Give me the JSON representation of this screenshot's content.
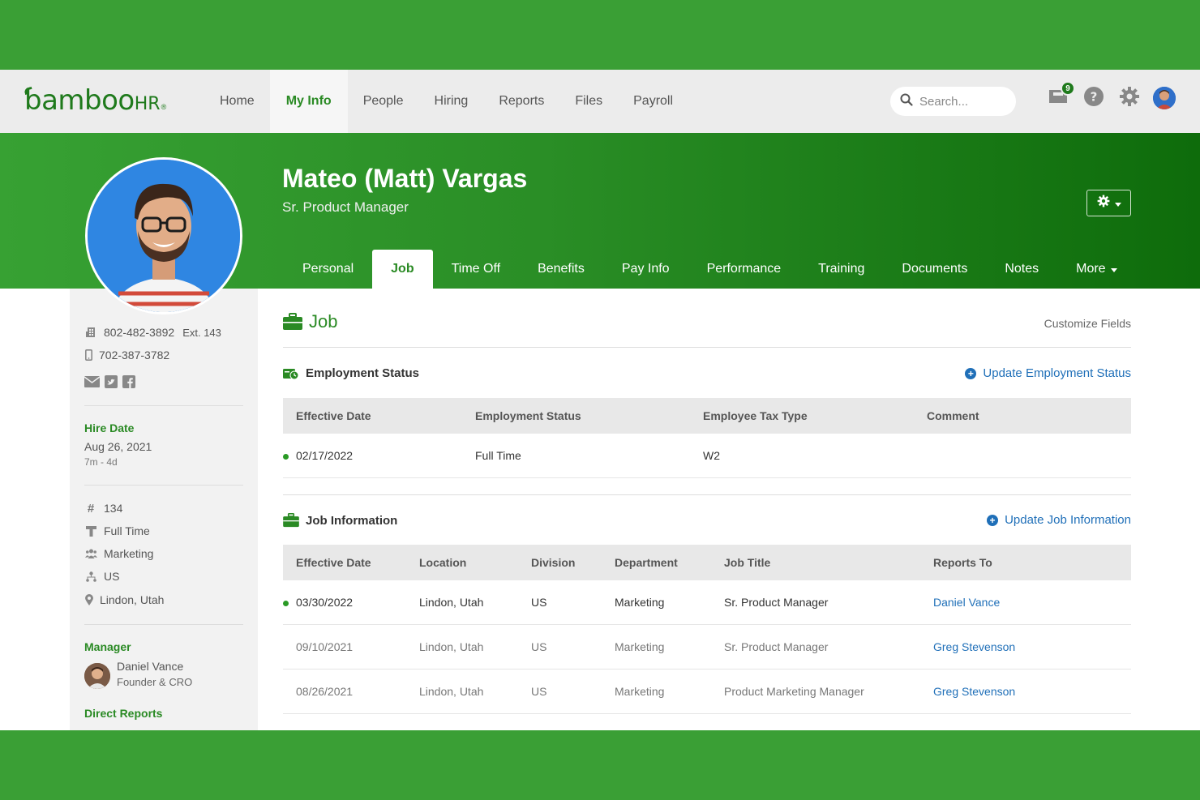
{
  "nav": {
    "logo_main": "bamboo",
    "logo_hr": "HR",
    "logo_reg": "®",
    "links": [
      "Home",
      "My Info",
      "People",
      "Hiring",
      "Reports",
      "Files",
      "Payroll"
    ],
    "active": "My Info",
    "search_placeholder": "Search...",
    "inbox_count": "9"
  },
  "profile": {
    "name": "Mateo (Matt) Vargas",
    "title": "Sr. Product Manager",
    "tabs": [
      "Personal",
      "Job",
      "Time Off",
      "Benefits",
      "Pay Info",
      "Performance",
      "Training",
      "Documents",
      "Notes",
      "More"
    ],
    "active_tab": "Job"
  },
  "sidebar": {
    "work_phone": "802-482-3892",
    "ext": "Ext. 143",
    "mobile_phone": "702-387-3782",
    "hire_date_label": "Hire Date",
    "hire_date": "Aug 26, 2021",
    "tenure": "7m - 4d",
    "employee_number": "134",
    "employment_type": "Full Time",
    "department": "Marketing",
    "division": "US",
    "location": "Lindon, Utah",
    "manager_label": "Manager",
    "manager_name": "Daniel Vance",
    "manager_title": "Founder & CRO",
    "direct_reports_label": "Direct Reports"
  },
  "job": {
    "section_title": "Job",
    "customize": "Customize Fields",
    "employment_status": {
      "title": "Employment Status",
      "action": "Update Employment Status",
      "headers": [
        "Effective Date",
        "Employment Status",
        "Employee Tax Type",
        "Comment"
      ],
      "rows": [
        [
          "02/17/2022",
          "Full Time",
          "W2",
          ""
        ]
      ]
    },
    "job_information": {
      "title": "Job Information",
      "action": "Update Job Information",
      "headers": [
        "Effective Date",
        "Location",
        "Division",
        "Department",
        "Job Title",
        "Reports To"
      ],
      "rows": [
        [
          "03/30/2022",
          "Lindon, Utah",
          "US",
          "Marketing",
          "Sr. Product Manager",
          "Daniel Vance"
        ],
        [
          "09/10/2021",
          "Lindon, Utah",
          "US",
          "Marketing",
          "Sr. Product Manager",
          "Greg Stevenson"
        ],
        [
          "08/26/2021",
          "Lindon, Utah",
          "US",
          "Marketing",
          "Product Marketing Manager",
          "Greg Stevenson"
        ]
      ]
    }
  },
  "colors": {
    "brand_green": "#2a8a24",
    "link_blue": "#1f6fb8",
    "frame_green": "#3a9f35"
  }
}
